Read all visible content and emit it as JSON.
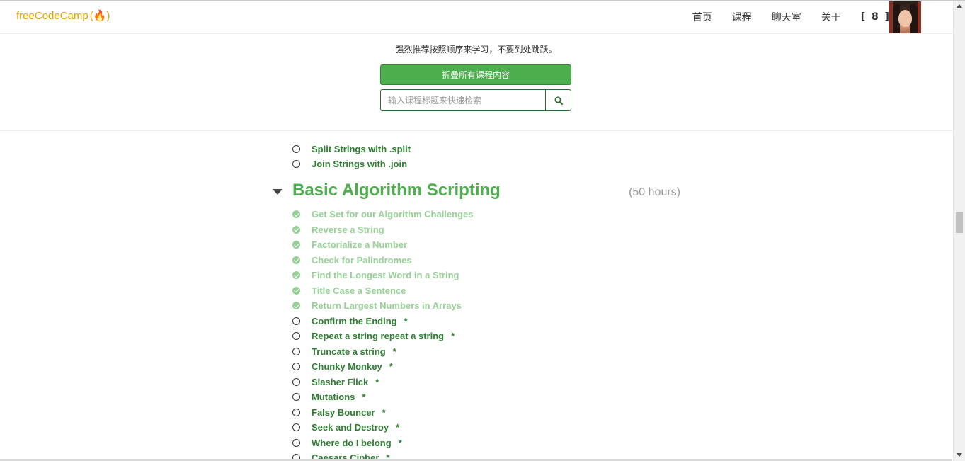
{
  "navbar": {
    "logo_prefix": "free",
    "logo_main": "CodeCamp",
    "logo_fire": "(🔥)",
    "links": [
      {
        "label": "首页"
      },
      {
        "label": "课程"
      },
      {
        "label": "聊天室"
      },
      {
        "label": "关于"
      }
    ],
    "points": "[ 8 ]",
    "avatar_icon": "user-avatar"
  },
  "panel": {
    "notice": "强烈推荐按照顺序来学习，不要到处跳跃。",
    "collapse_label": "折叠所有课程内容",
    "search_placeholder": "输入课程标题来快速检索",
    "search_icon": "search-icon"
  },
  "previous_challenges": [
    {
      "title": "Split Strings with .split",
      "done": false
    },
    {
      "title": "Join Strings with .join",
      "done": false
    }
  ],
  "section": {
    "title": "Basic Algorithm Scripting",
    "hours": "(50 hours)",
    "expanded": true
  },
  "challenges": [
    {
      "title": "Get Set for our Algorithm Challenges",
      "done": true,
      "star": ""
    },
    {
      "title": "Reverse a String",
      "done": true,
      "star": ""
    },
    {
      "title": "Factorialize a Number",
      "done": true,
      "star": ""
    },
    {
      "title": "Check for Palindromes",
      "done": true,
      "star": ""
    },
    {
      "title": "Find the Longest Word in a String",
      "done": true,
      "star": ""
    },
    {
      "title": "Title Case a Sentence",
      "done": true,
      "star": ""
    },
    {
      "title": "Return Largest Numbers in Arrays",
      "done": true,
      "star": ""
    },
    {
      "title": "Confirm the Ending",
      "done": false,
      "star": "*"
    },
    {
      "title": "Repeat a string repeat a string",
      "done": false,
      "star": "*"
    },
    {
      "title": "Truncate a string",
      "done": false,
      "star": "*"
    },
    {
      "title": "Chunky Monkey",
      "done": false,
      "star": "*"
    },
    {
      "title": "Slasher Flick",
      "done": false,
      "star": "*"
    },
    {
      "title": "Mutations",
      "done": false,
      "star": "*"
    },
    {
      "title": "Falsy Bouncer",
      "done": false,
      "star": "*"
    },
    {
      "title": "Seek and Destroy",
      "done": false,
      "star": "*"
    },
    {
      "title": "Where do I belong",
      "done": false,
      "star": "*"
    },
    {
      "title": "Caesars Cipher",
      "done": false,
      "star": "*"
    }
  ],
  "colors": {
    "brand_green": "#4cae4c",
    "done_green": "#96d096",
    "todo_green": "#2e7d32",
    "logo_orange": "#e0a100"
  }
}
